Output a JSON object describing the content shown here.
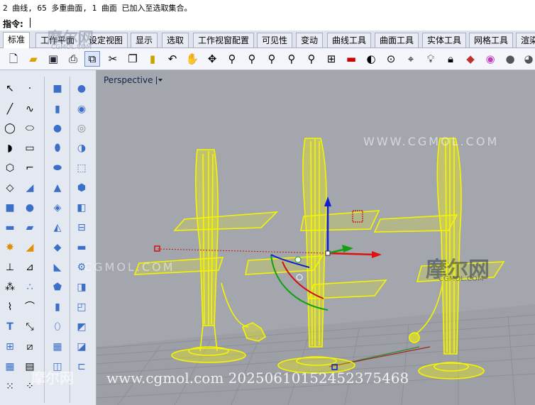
{
  "command": {
    "history": "2 曲线, 65 多重曲面, 1 曲面 已加入至选取集合。",
    "prompt_label": "指令:"
  },
  "tabs": [
    "标准",
    "工作平面",
    "设定视图",
    "显示",
    "选取",
    "工作视窗配置",
    "可见性",
    "变动",
    "曲线工具",
    "曲面工具",
    "实体工具",
    "网格工具",
    "渲染"
  ],
  "active_tab": "标准",
  "toolbar_icons": [
    "new-icon",
    "open-icon",
    "save-icon",
    "print-icon",
    "import-icon",
    "cut-icon",
    "copy-icon",
    "paste-icon",
    "undo-icon",
    "pan-icon",
    "rotate-view-icon",
    "zoom-icon",
    "zoom-extents-icon",
    "zoom-window-icon",
    "zoom-selected-icon",
    "zoom-all-icon",
    "four-views-icon",
    "car-icon",
    "sphere-cam-icon",
    "target-icon",
    "cplane-icon",
    "lock-icon",
    "light-icon",
    "padlock-icon",
    "color-icon",
    "sphere-icon",
    "render-icon",
    "more-icon"
  ],
  "viewport": {
    "name": "Perspective"
  },
  "watermarks": {
    "site_top": "WWW.CGMOL.COM",
    "logo_right": "摩尔网",
    "logo_right_small": "CGMOL.COM",
    "site_left": "CGMOL.COM",
    "logo_tab": "摩尔网",
    "logo_tab_small": "CGMOL.COM",
    "logo_bottom": "摩尔网",
    "footer": "www.cgmol.com 20250610152452375468"
  },
  "colors": {
    "viewport_bg": "#a3a7ad",
    "grid": "#8d9097",
    "wire": "#f5f500",
    "x_axis": "#e01010",
    "y_axis": "#10a010",
    "z_axis": "#1020d0"
  }
}
